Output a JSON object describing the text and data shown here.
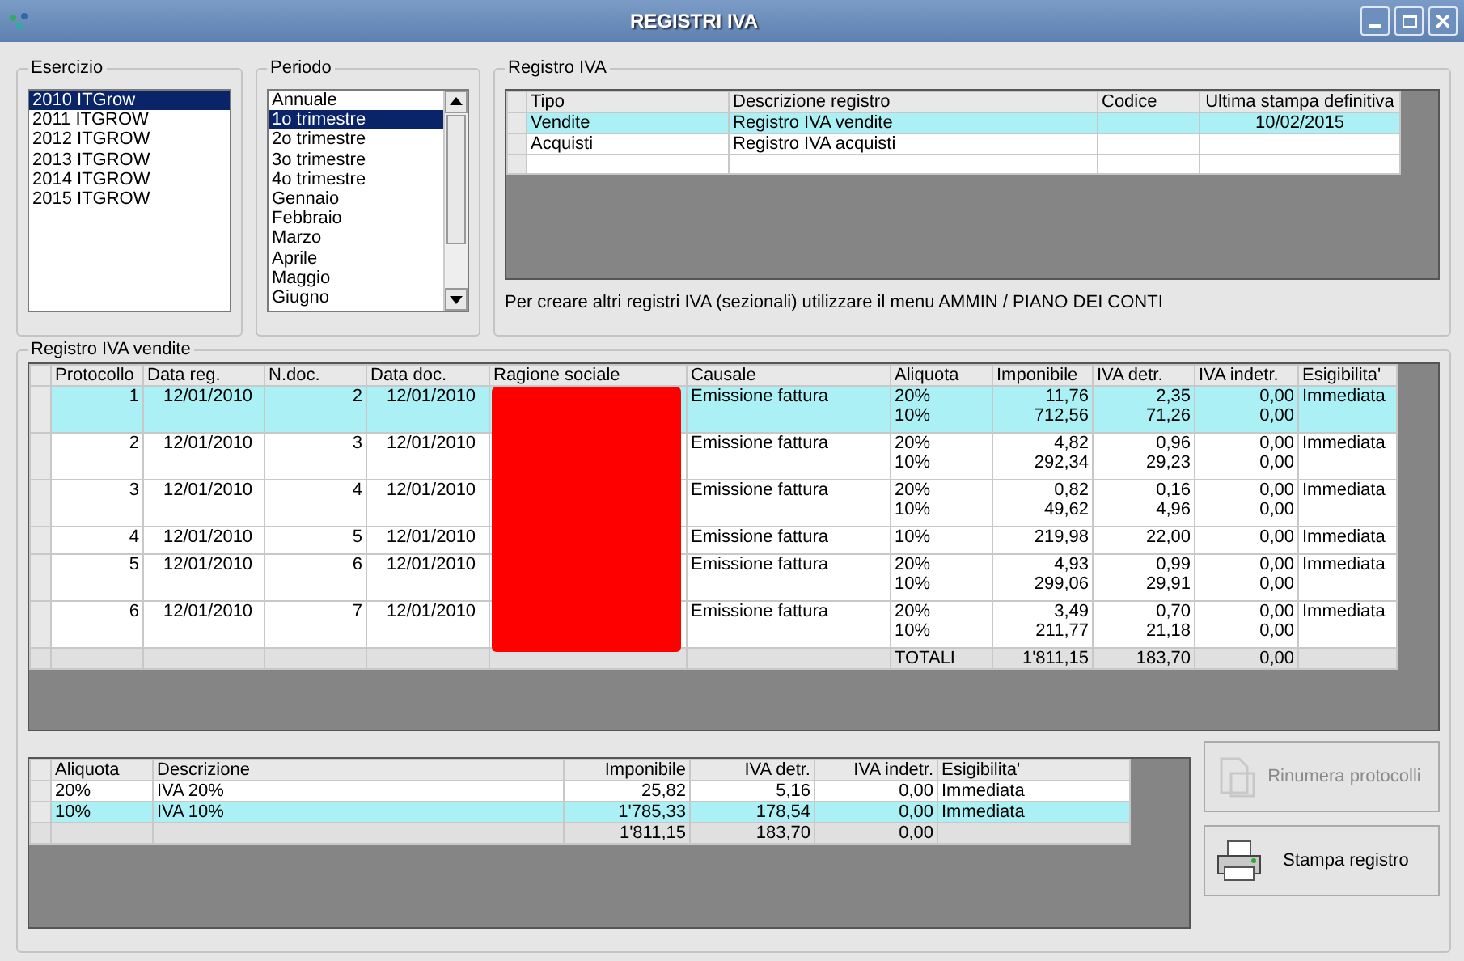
{
  "window": {
    "title": "REGISTRI IVA"
  },
  "esercizio": {
    "label": "Esercizio",
    "items": [
      {
        "label": "2010 ITGrow",
        "selected": true
      },
      {
        "label": "2011 ITGROW",
        "selected": false
      },
      {
        "label": "2012 ITGROW",
        "selected": false
      },
      {
        "label": "2013 ITGROW",
        "selected": false
      },
      {
        "label": "2014 ITGROW",
        "selected": false
      },
      {
        "label": "2015 ITGROW",
        "selected": false
      }
    ]
  },
  "periodo": {
    "label": "Periodo",
    "items": [
      {
        "label": "Annuale",
        "selected": false
      },
      {
        "label": "1o trimestre",
        "selected": true
      },
      {
        "label": "2o trimestre",
        "selected": false
      },
      {
        "label": "3o trimestre",
        "selected": false
      },
      {
        "label": "4o trimestre",
        "selected": false
      },
      {
        "label": "Gennaio",
        "selected": false
      },
      {
        "label": "Febbraio",
        "selected": false
      },
      {
        "label": "Marzo",
        "selected": false
      },
      {
        "label": "Aprile",
        "selected": false
      },
      {
        "label": "Maggio",
        "selected": false
      },
      {
        "label": "Giugno",
        "selected": false
      }
    ]
  },
  "registro_iva": {
    "label": "Registro IVA",
    "columns": [
      "Tipo",
      "Descrizione registro",
      "Codice",
      "Ultima stampa definitiva"
    ],
    "rows": [
      {
        "tipo": "Vendite",
        "descrizione": "Registro IVA vendite",
        "codice": "",
        "ultima_stampa": "10/02/2015",
        "selected": true
      },
      {
        "tipo": "Acquisti",
        "descrizione": "Registro IVA acquisti",
        "codice": "",
        "ultima_stampa": "",
        "selected": false
      }
    ],
    "note": "Per creare altri registri IVA (sezionali) utilizzare il menu AMMIN / PIANO DEI CONTI"
  },
  "vendite": {
    "label": "Registro IVA vendite",
    "columns": [
      "Protocollo",
      "Data reg.",
      "N.doc.",
      "Data doc.",
      "Ragione sociale",
      "Causale",
      "Aliquota",
      "Imponibile",
      "IVA detr.",
      "IVA indetr.",
      "Esigibilita'"
    ],
    "ragione_sociale_redacted": true,
    "rows": [
      {
        "protocollo": "1",
        "data_reg": "12/01/2010",
        "ndoc": "2",
        "data_doc": "12/01/2010",
        "causale": "Emissione fattura",
        "esigibilita": "Immediata",
        "selected": true,
        "lines": [
          {
            "aliquota": "20%",
            "imponibile": "11,76",
            "iva_detr": "2,35",
            "iva_indetr": "0,00"
          },
          {
            "aliquota": "10%",
            "imponibile": "712,56",
            "iva_detr": "71,26",
            "iva_indetr": "0,00"
          }
        ]
      },
      {
        "protocollo": "2",
        "data_reg": "12/01/2010",
        "ndoc": "3",
        "data_doc": "12/01/2010",
        "causale": "Emissione fattura",
        "esigibilita": "Immediata",
        "selected": false,
        "lines": [
          {
            "aliquota": "20%",
            "imponibile": "4,82",
            "iva_detr": "0,96",
            "iva_indetr": "0,00"
          },
          {
            "aliquota": "10%",
            "imponibile": "292,34",
            "iva_detr": "29,23",
            "iva_indetr": "0,00"
          }
        ]
      },
      {
        "protocollo": "3",
        "data_reg": "12/01/2010",
        "ndoc": "4",
        "data_doc": "12/01/2010",
        "causale": "Emissione fattura",
        "esigibilita": "Immediata",
        "selected": false,
        "lines": [
          {
            "aliquota": "20%",
            "imponibile": "0,82",
            "iva_detr": "0,16",
            "iva_indetr": "0,00"
          },
          {
            "aliquota": "10%",
            "imponibile": "49,62",
            "iva_detr": "4,96",
            "iva_indetr": "0,00"
          }
        ]
      },
      {
        "protocollo": "4",
        "data_reg": "12/01/2010",
        "ndoc": "5",
        "data_doc": "12/01/2010",
        "causale": "Emissione fattura",
        "esigibilita": "Immediata",
        "selected": false,
        "lines": [
          {
            "aliquota": "10%",
            "imponibile": "219,98",
            "iva_detr": "22,00",
            "iva_indetr": "0,00"
          }
        ]
      },
      {
        "protocollo": "5",
        "data_reg": "12/01/2010",
        "ndoc": "6",
        "data_doc": "12/01/2010",
        "causale": "Emissione fattura",
        "esigibilita": "Immediata",
        "selected": false,
        "lines": [
          {
            "aliquota": "20%",
            "imponibile": "4,93",
            "iva_detr": "0,99",
            "iva_indetr": "0,00"
          },
          {
            "aliquota": "10%",
            "imponibile": "299,06",
            "iva_detr": "29,91",
            "iva_indetr": "0,00"
          }
        ]
      },
      {
        "protocollo": "6",
        "data_reg": "12/01/2010",
        "ndoc": "7",
        "data_doc": "12/01/2010",
        "causale": "Emissione fattura",
        "esigibilita": "Immediata",
        "selected": false,
        "lines": [
          {
            "aliquota": "20%",
            "imponibile": "3,49",
            "iva_detr": "0,70",
            "iva_indetr": "0,00"
          },
          {
            "aliquota": "10%",
            "imponibile": "211,77",
            "iva_detr": "21,18",
            "iva_indetr": "0,00"
          }
        ]
      }
    ],
    "totals": {
      "label": "TOTALI",
      "imponibile": "1'811,15",
      "iva_detr": "183,70",
      "iva_indetr": "0,00"
    }
  },
  "riepilogo": {
    "columns": [
      "Aliquota",
      "Descrizione",
      "Imponibile",
      "IVA detr.",
      "IVA indetr.",
      "Esigibilita'"
    ],
    "rows": [
      {
        "aliquota": "20%",
        "descrizione": "IVA 20%",
        "imponibile": "25,82",
        "iva_detr": "5,16",
        "iva_indetr": "0,00",
        "esigibilita": "Immediata",
        "selected": false
      },
      {
        "aliquota": "10%",
        "descrizione": "IVA 10%",
        "imponibile": "1'785,33",
        "iva_detr": "178,54",
        "iva_indetr": "0,00",
        "esigibilita": "Immediata",
        "selected": true
      }
    ],
    "totals": {
      "imponibile": "1'811,15",
      "iva_detr": "183,70",
      "iva_indetr": "0,00"
    }
  },
  "buttons": [
    {
      "kind": "renumber",
      "label": "Rinumera protocolli",
      "disabled": true
    },
    {
      "kind": "print",
      "label": "Stampa registro",
      "disabled": false
    }
  ]
}
